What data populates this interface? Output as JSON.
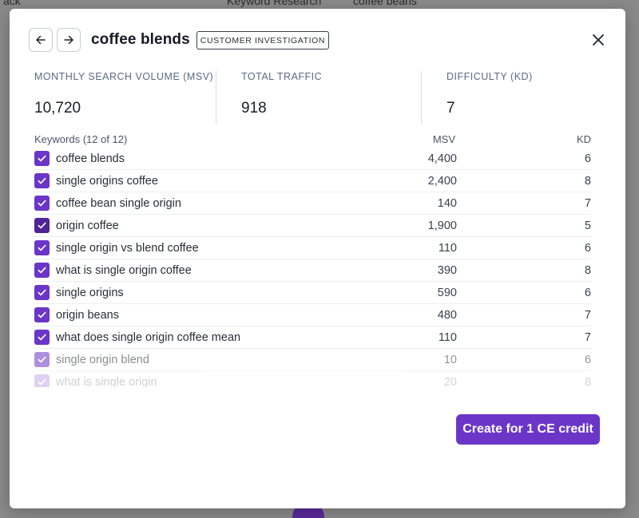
{
  "background": {
    "top_left": "ack",
    "top_center": "Keyword Research",
    "top_right": "coffee beans"
  },
  "modal": {
    "title": "coffee blends",
    "badge": "CUSTOMER INVESTIGATION",
    "back_icon": "arrow-left-icon",
    "forward_icon": "arrow-right-icon",
    "close_icon": "close-icon"
  },
  "stats": [
    {
      "label": "MONTHLY SEARCH VOLUME (MSV)",
      "value": "10,720"
    },
    {
      "label": "TOTAL TRAFFIC",
      "value": "918"
    },
    {
      "label": "DIFFICULTY (KD)",
      "value": "7"
    }
  ],
  "table": {
    "header_keywords": "Keywords (12 of 12)",
    "header_msv": "MSV",
    "header_kd": "KD",
    "rows": [
      {
        "keyword": "coffee blends",
        "msv": "4,400",
        "kd": "6"
      },
      {
        "keyword": "single origins coffee",
        "msv": "2,400",
        "kd": "8"
      },
      {
        "keyword": "coffee bean single origin",
        "msv": "140",
        "kd": "7"
      },
      {
        "keyword": "origin coffee",
        "msv": "1,900",
        "kd": "5"
      },
      {
        "keyword": "single origin vs blend coffee",
        "msv": "110",
        "kd": "6"
      },
      {
        "keyword": "what is single origin coffee",
        "msv": "390",
        "kd": "8"
      },
      {
        "keyword": "single origins",
        "msv": "590",
        "kd": "6"
      },
      {
        "keyword": "origin beans",
        "msv": "480",
        "kd": "7"
      },
      {
        "keyword": "what does single origin coffee mean",
        "msv": "110",
        "kd": "7"
      },
      {
        "keyword": "single origin blend",
        "msv": "10",
        "kd": "6"
      },
      {
        "keyword": "what is single origin",
        "msv": "20",
        "kd": "8"
      }
    ]
  },
  "cta_label": "Create for 1 CE credit",
  "colors": {
    "accent": "#6b36c8",
    "checkbox_active": "#4e2596"
  }
}
